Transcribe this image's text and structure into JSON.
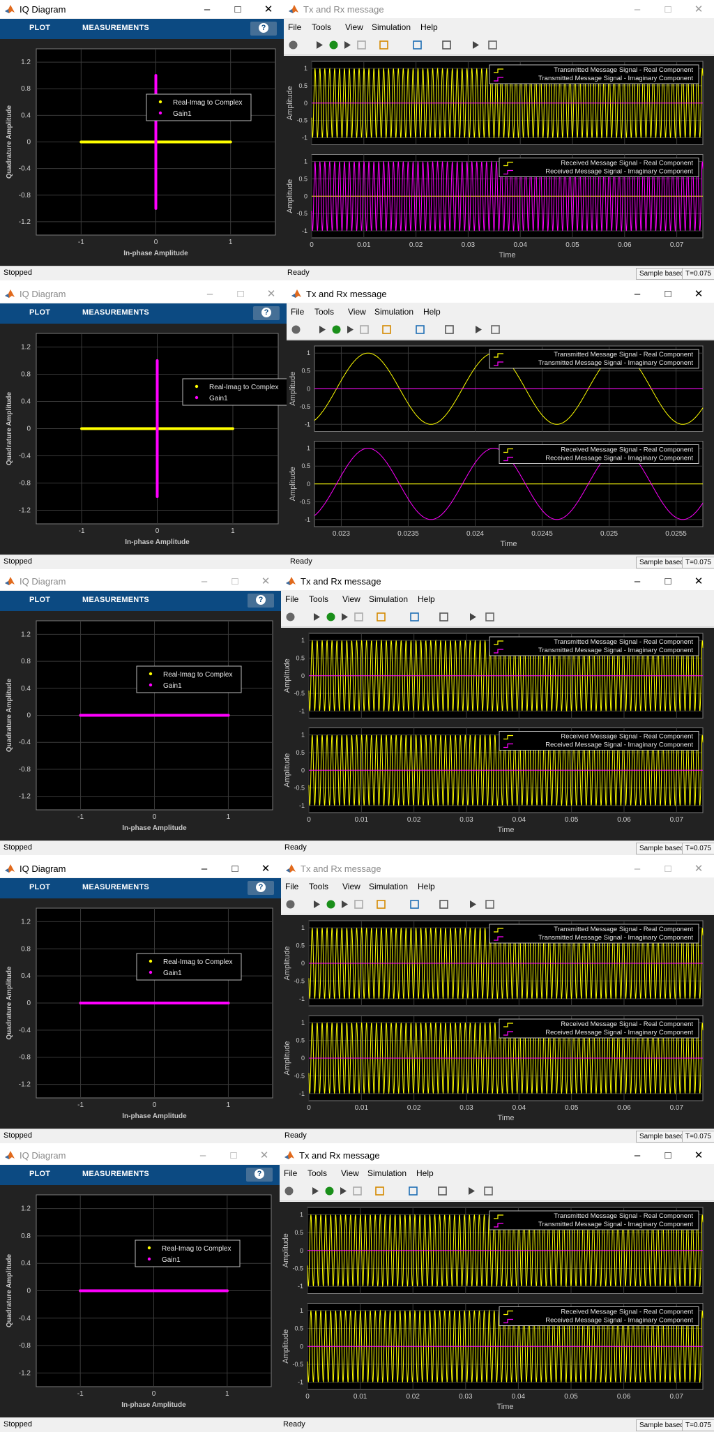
{
  "iq": {
    "title": "IQ Diagram",
    "tabs": {
      "plot": "PLOT",
      "measurements": "MEASUREMENTS"
    },
    "help": "?",
    "status": "Stopped",
    "xlabel": "In-phase Amplitude",
    "ylabel": "Quadrature Amplitude",
    "xticks": [
      "-1",
      "0",
      "1"
    ],
    "yticks": [
      "1.2",
      "0.8",
      "0.4",
      "0",
      "-0.4",
      "-0.8",
      "-1.2"
    ],
    "legend": [
      "Real-Imag to Complex",
      "Gain1"
    ]
  },
  "scope": {
    "title": "Tx and Rx message",
    "menu": [
      "File",
      "Tools",
      "View",
      "Simulation",
      "Help"
    ],
    "status": "Ready",
    "sample_mode": "Sample based",
    "time": "T=0.075",
    "ylabel": "Amplitude",
    "xlabel": "Time",
    "yticks": [
      "1",
      "0.5",
      "0",
      "-0.5",
      "-1"
    ],
    "xticks_full": [
      "0",
      "0.01",
      "0.02",
      "0.03",
      "0.04",
      "0.05",
      "0.06",
      "0.07"
    ],
    "xticks_zoom": [
      "0.023",
      "0.0235",
      "0.024",
      "0.0245",
      "0.025",
      "0.0255"
    ],
    "tx_legend": [
      "Transmitted Message Signal - Real Component",
      "Transmitted Message Signal - Imaginary Component"
    ],
    "rx_legend": [
      "Received Message Signal - Real Component",
      "Received Message Signal - Imaginary Component"
    ]
  },
  "colors": {
    "yellow": "#ffff00",
    "magenta": "#ff00ff",
    "plot_bg": "#000000",
    "panel_bg": "#222222",
    "tab_bar": "#0c4a82"
  },
  "chart_data": [
    {
      "type": "scatter",
      "panel": 1,
      "series": [
        {
          "name": "Real-Imag to Complex",
          "points": [
            [
              -1,
              0
            ],
            [
              1,
              0
            ]
          ]
        },
        {
          "name": "Gain1",
          "points": [
            [
              0,
              -1
            ],
            [
              0,
              1
            ]
          ]
        }
      ],
      "xlim": [
        -1.6,
        1.6
      ],
      "ylim": [
        -1.4,
        1.4
      ],
      "grid": true,
      "legend": "top-right"
    },
    {
      "type": "line",
      "panel": 1,
      "series": [
        {
          "name": "Transmitted Message Signal - Real Component",
          "shape": "cos",
          "amplitude": 1
        },
        {
          "name": "Transmitted Message Signal - Imaginary Component",
          "shape": "flat",
          "amplitude": 0
        }
      ],
      "xlim": [
        0,
        0.075
      ],
      "ylim": [
        -1.2,
        1.2
      ],
      "grid": true,
      "legend": "top-right"
    },
    {
      "type": "line",
      "panel": 1,
      "series": [
        {
          "name": "Received Message Signal - Real Component",
          "shape": "flat",
          "amplitude": 0
        },
        {
          "name": "Received Message Signal - Imaginary Component",
          "shape": "sin",
          "amplitude": 1
        }
      ],
      "xlim": [
        0,
        0.075
      ],
      "ylim": [
        -1.2,
        1.2
      ],
      "grid": true,
      "legend": "top-right"
    },
    {
      "type": "scatter",
      "panel": 2,
      "series": [
        {
          "name": "Real-Imag to Complex",
          "points": [
            [
              -1,
              0
            ],
            [
              1,
              0
            ]
          ]
        },
        {
          "name": "Gain1",
          "points": [
            [
              0,
              -1
            ],
            [
              0,
              1
            ]
          ]
        }
      ],
      "xlim": [
        -1.6,
        1.6
      ],
      "ylim": [
        -1.4,
        1.4
      ],
      "grid": true,
      "legend": "top-right"
    },
    {
      "type": "line",
      "panel": 2,
      "series": [
        {
          "name": "Transmitted Message Signal - Real Component",
          "shape": "cos",
          "amplitude": 1
        },
        {
          "name": "Transmitted Message Signal - Imaginary Component",
          "shape": "flat",
          "amplitude": 0
        }
      ],
      "xlim": [
        0.0228,
        0.0257
      ],
      "ylim": [
        -1.2,
        1.2
      ],
      "grid": true,
      "legend": "top-right"
    },
    {
      "type": "line",
      "panel": 2,
      "series": [
        {
          "name": "Received Message Signal - Real Component",
          "shape": "flat",
          "amplitude": 0
        },
        {
          "name": "Received Message Signal - Imaginary Component",
          "shape": "sin",
          "amplitude": 1
        }
      ],
      "xlim": [
        0.0228,
        0.0257
      ],
      "ylim": [
        -1.2,
        1.2
      ],
      "grid": true,
      "legend": "top-right"
    },
    {
      "type": "scatter",
      "panel": 3,
      "series": [
        {
          "name": "Real-Imag to Complex",
          "points": [
            [
              -1,
              0
            ],
            [
              1,
              0
            ]
          ]
        },
        {
          "name": "Gain1",
          "points": [
            [
              -1,
              0
            ],
            [
              1,
              0
            ]
          ]
        }
      ],
      "xlim": [
        -1.6,
        1.6
      ],
      "ylim": [
        -1.4,
        1.4
      ],
      "grid": true,
      "legend": "top-right"
    },
    {
      "type": "line",
      "panel": 3,
      "series": [
        {
          "name": "Transmitted Message Signal - Real Component",
          "shape": "cos",
          "amplitude": 1
        },
        {
          "name": "Transmitted Message Signal - Imaginary Component",
          "shape": "flat",
          "amplitude": 0
        }
      ],
      "xlim": [
        0,
        0.075
      ],
      "ylim": [
        -1.2,
        1.2
      ],
      "grid": true,
      "legend": "top-right"
    },
    {
      "type": "line",
      "panel": 3,
      "series": [
        {
          "name": "Received Message Signal - Real Component",
          "shape": "cos",
          "amplitude": 1
        },
        {
          "name": "Received Message Signal - Imaginary Component",
          "shape": "flat",
          "amplitude": 0
        }
      ],
      "xlim": [
        0,
        0.075
      ],
      "ylim": [
        -1.2,
        1.2
      ],
      "grid": true,
      "legend": "top-right"
    },
    {
      "type": "scatter",
      "panel": 4,
      "series": [
        {
          "name": "Real-Imag to Complex",
          "points": [
            [
              -1,
              0
            ],
            [
              1,
              0
            ]
          ]
        },
        {
          "name": "Gain1",
          "points": [
            [
              -1,
              0
            ],
            [
              1,
              0
            ]
          ]
        }
      ],
      "xlim": [
        -1.6,
        1.6
      ],
      "ylim": [
        -1.4,
        1.4
      ],
      "grid": true,
      "legend": "top-right"
    },
    {
      "type": "line",
      "panel": 4,
      "series": [
        {
          "name": "Transmitted Message Signal - Real Component",
          "shape": "cos",
          "amplitude": 1
        },
        {
          "name": "Transmitted Message Signal - Imaginary Component",
          "shape": "flat",
          "amplitude": 0
        }
      ],
      "xlim": [
        0,
        0.075
      ],
      "ylim": [
        -1.2,
        1.2
      ],
      "grid": true,
      "legend": "top-right"
    },
    {
      "type": "line",
      "panel": 4,
      "series": [
        {
          "name": "Received Message Signal - Real Component",
          "shape": "cos",
          "amplitude": 1
        },
        {
          "name": "Received Message Signal - Imaginary Component",
          "shape": "flat",
          "amplitude": 0
        }
      ],
      "xlim": [
        0,
        0.075
      ],
      "ylim": [
        -1.2,
        1.2
      ],
      "grid": true,
      "legend": "top-right"
    },
    {
      "type": "scatter",
      "panel": 5,
      "series": [
        {
          "name": "Real-Imag to Complex",
          "points": [
            [
              -1,
              0
            ],
            [
              1,
              0
            ]
          ]
        },
        {
          "name": "Gain1",
          "points": [
            [
              -1,
              0
            ],
            [
              1,
              0
            ]
          ]
        }
      ],
      "xlim": [
        -1.6,
        1.6
      ],
      "ylim": [
        -1.4,
        1.4
      ],
      "grid": true,
      "legend": "top-right"
    },
    {
      "type": "line",
      "panel": 5,
      "series": [
        {
          "name": "Transmitted Message Signal - Real Component",
          "shape": "cos",
          "amplitude": 1
        },
        {
          "name": "Transmitted Message Signal - Imaginary Component",
          "shape": "flat",
          "amplitude": 0
        }
      ],
      "xlim": [
        0,
        0.075
      ],
      "ylim": [
        -1.2,
        1.2
      ],
      "grid": true,
      "legend": "top-right"
    },
    {
      "type": "line",
      "panel": 5,
      "series": [
        {
          "name": "Received Message Signal - Real Component",
          "shape": "cos",
          "amplitude": 1
        },
        {
          "name": "Received Message Signal - Imaginary Component",
          "shape": "flat",
          "amplitude": 0
        }
      ],
      "xlim": [
        0,
        0.075
      ],
      "ylim": [
        -1.2,
        1.2
      ],
      "grid": true,
      "legend": "top-right"
    }
  ]
}
